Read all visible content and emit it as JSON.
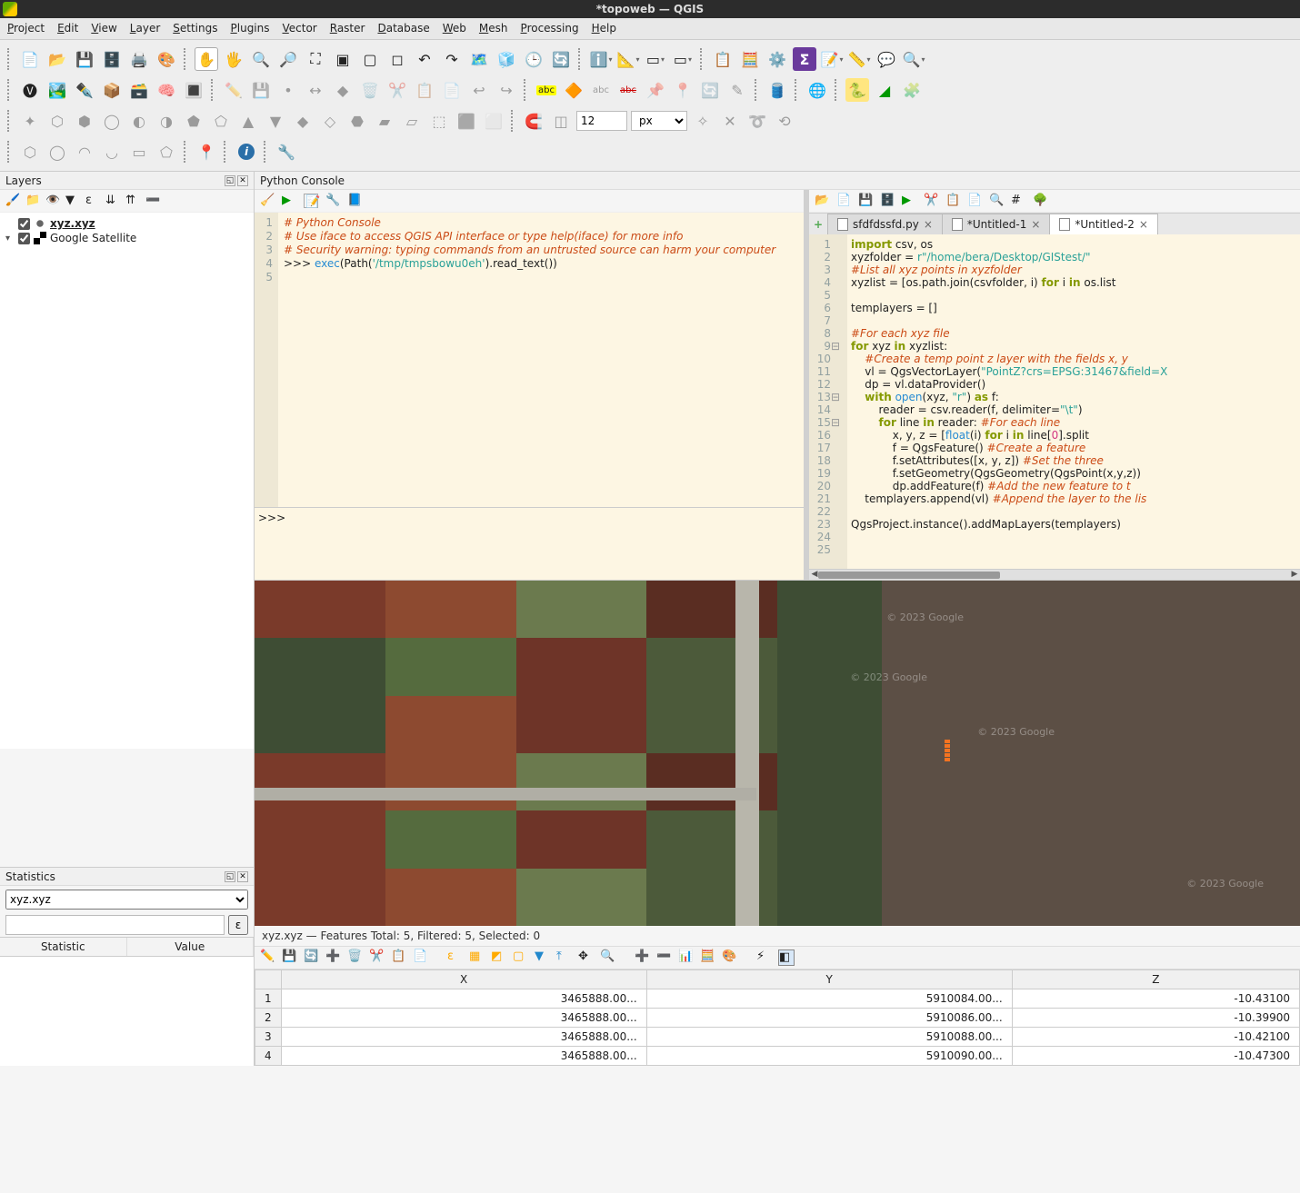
{
  "title": "*topoweb — QGIS",
  "menubar": [
    "Project",
    "Edit",
    "View",
    "Layer",
    "Settings",
    "Plugins",
    "Vector",
    "Raster",
    "Database",
    "Web",
    "Mesh",
    "Processing",
    "Help"
  ],
  "segment_value": "12",
  "segment_unit": "px",
  "panels": {
    "layers_title": "Layers",
    "stats_title": "Statistics",
    "console_title": "Python Console"
  },
  "layers": [
    {
      "name": "xyz.xyz",
      "checked": true,
      "icon": "pt",
      "active": true,
      "expander": ""
    },
    {
      "name": "Google Satellite",
      "checked": true,
      "icon": "sat",
      "active": false,
      "expander": "▾"
    }
  ],
  "stats_layer": "xyz.xyz",
  "stat_headers": [
    "Statistic",
    "Value"
  ],
  "console": {
    "lines": [
      {
        "n": 1,
        "html": "<span class='c-comment'># Python Console</span>"
      },
      {
        "n": 2,
        "html": "<span class='c-comment'># Use iface to access QGIS API interface or type help(iface) for more info</span>"
      },
      {
        "n": 3,
        "html": "<span class='c-comment'># Security warning: typing commands from an untrusted source can harm your computer</span>"
      },
      {
        "n": 4,
        "html": ">>> <span class='c-fn'>exec</span>(Path(<span class='c-str'>'/tmp/tmpsbowu0eh'</span>).read_text())"
      },
      {
        "n": 5,
        "html": " "
      }
    ],
    "prompt": ">>> "
  },
  "editor": {
    "tabs": [
      {
        "label": "sfdfdssfd.py",
        "active": false
      },
      {
        "label": "*Untitled-1",
        "active": false
      },
      {
        "label": "*Untitled-2",
        "active": true
      }
    ],
    "code": [
      {
        "n": 1,
        "fold": "",
        "html": "<span class='c-kw'>import</span> csv, os"
      },
      {
        "n": 2,
        "fold": "",
        "html": "xyzfolder = <span class='c-str'>r\"/home/bera/Desktop/GIStest/\"</span>"
      },
      {
        "n": 3,
        "fold": "",
        "html": "<span class='c-comment'>#List all xyz points in xyzfolder</span>"
      },
      {
        "n": 4,
        "fold": "",
        "html": "xyzlist = [os.path.join(csvfolder, i) <span class='c-kw'>for</span> i <span class='c-kw'>in</span> os.list"
      },
      {
        "n": 5,
        "fold": "",
        "html": " "
      },
      {
        "n": 6,
        "fold": "",
        "html": "templayers = []"
      },
      {
        "n": 7,
        "fold": "",
        "html": " "
      },
      {
        "n": 8,
        "fold": "",
        "html": "<span class='c-comment'>#For each xyz file</span>"
      },
      {
        "n": 9,
        "fold": "⊟",
        "html": "<span class='c-kw'>for</span> xyz <span class='c-kw'>in</span> xyzlist:"
      },
      {
        "n": 10,
        "fold": "",
        "html": "    <span class='c-comment'>#Create a temp point z layer with the fields x, y </span>"
      },
      {
        "n": 11,
        "fold": "",
        "html": "    vl = QgsVectorLayer(<span class='c-str'>\"PointZ?crs=EPSG:31467&field=X</span>"
      },
      {
        "n": 12,
        "fold": "",
        "html": "    dp = vl.dataProvider()"
      },
      {
        "n": 13,
        "fold": "⊟",
        "html": "    <span class='c-kw'>with</span> <span class='c-fn'>open</span>(xyz, <span class='c-str'>\"r\"</span>) <span class='c-kw'>as</span> f:"
      },
      {
        "n": 14,
        "fold": "",
        "html": "        reader = csv.reader(f, delimiter=<span class='c-str'>\"\\t\"</span>)"
      },
      {
        "n": 15,
        "fold": "⊟",
        "html": "        <span class='c-kw'>for</span> line <span class='c-kw'>in</span> reader: <span class='c-comment'>#For each line</span>"
      },
      {
        "n": 16,
        "fold": "",
        "html": "            x, y, z = [<span class='c-fn'>float</span>(i) <span class='c-kw'>for</span> i <span class='c-kw'>in</span> line[<span class='c-num'>0</span>].split"
      },
      {
        "n": 17,
        "fold": "",
        "html": "            f = QgsFeature() <span class='c-comment'>#Create a feature</span>"
      },
      {
        "n": 18,
        "fold": "",
        "html": "            f.setAttributes([x, y, z]) <span class='c-comment'>#Set the three</span>"
      },
      {
        "n": 19,
        "fold": "",
        "html": "            f.setGeometry(QgsGeometry(QgsPoint(x,y,z))"
      },
      {
        "n": 20,
        "fold": "",
        "html": "            dp.addFeature(f) <span class='c-comment'>#Add the new feature to t</span>"
      },
      {
        "n": 21,
        "fold": "",
        "html": "    templayers.append(vl) <span class='c-comment'>#Append the layer to the lis</span>"
      },
      {
        "n": 22,
        "fold": "",
        "html": " "
      },
      {
        "n": 23,
        "fold": "",
        "html": "QgsProject.instance().addMapLayers(templayers)"
      },
      {
        "n": 24,
        "fold": "",
        "html": " "
      },
      {
        "n": 25,
        "fold": "",
        "html": " "
      }
    ]
  },
  "watermark": "© 2023 Google",
  "attr_info": "xyz.xyz — Features Total: 5, Filtered: 5, Selected: 0",
  "attr_cols": [
    "X",
    "Y",
    "Z"
  ],
  "attr_rows": [
    {
      "n": 1,
      "x": "3465888.00...",
      "y": "5910084.00...",
      "z": "-10.43100"
    },
    {
      "n": 2,
      "x": "3465888.00...",
      "y": "5910086.00...",
      "z": "-10.39900"
    },
    {
      "n": 3,
      "x": "3465888.00...",
      "y": "5910088.00...",
      "z": "-10.42100"
    },
    {
      "n": 4,
      "x": "3465888.00...",
      "y": "5910090.00...",
      "z": "-10.47300"
    }
  ]
}
